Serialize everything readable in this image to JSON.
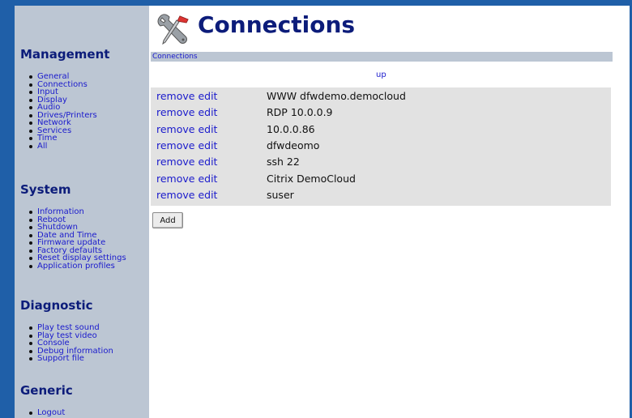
{
  "title": "Connections",
  "breadcrumb": "Connections",
  "up_label": "up",
  "add_label": "Add",
  "row_actions": {
    "remove": "remove",
    "edit": "edit"
  },
  "connections": [
    "WWW dfwdemo.democloud",
    "RDP 10.0.0.9",
    "10.0.0.86",
    "dfwdeomo",
    "ssh 22",
    "Citrix DemoCloud",
    "suser"
  ],
  "sidebar": {
    "management": {
      "heading": "Management",
      "items": [
        "General",
        "Connections",
        "Input",
        "Display",
        "Audio",
        "Drives/Printers",
        "Network",
        "Services",
        "Time",
        "All"
      ]
    },
    "system": {
      "heading": "System",
      "items": [
        "Information",
        "Reboot",
        "Shutdown",
        "Date and Time",
        "Firmware update",
        "Factory defaults",
        "Reset display settings",
        "Application profiles"
      ]
    },
    "diagnostic": {
      "heading": "Diagnostic",
      "items": [
        "Play test sound",
        "Play test video",
        "Console",
        "Debug information",
        "Support file"
      ]
    },
    "generic": {
      "heading": "Generic",
      "items": [
        "Logout"
      ]
    }
  },
  "colors": {
    "frame": "#1f5fa8",
    "sidebar": "#bcc6d3",
    "heading": "#0c1c7a",
    "link": "#1a1acc",
    "table": "#e2e2e2"
  },
  "icons": {
    "title": "tools-icon"
  }
}
